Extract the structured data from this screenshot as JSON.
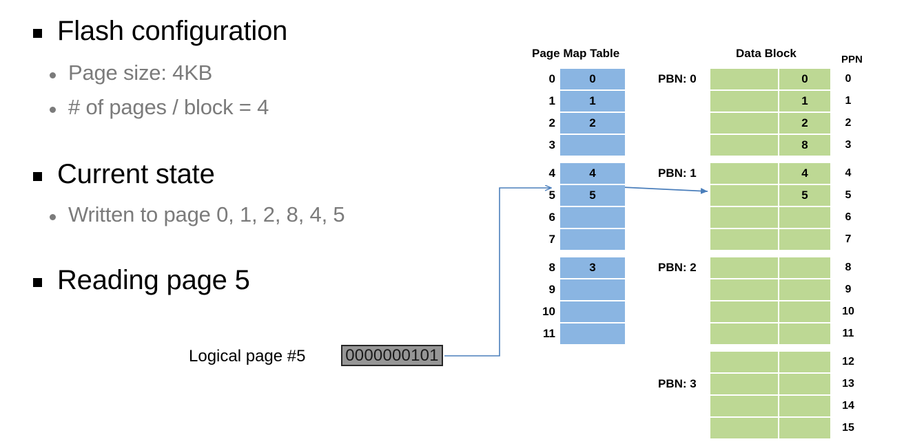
{
  "slide": {
    "bullets": [
      {
        "level": 1,
        "text": "Flash configuration"
      },
      {
        "level": 2,
        "text": "Page size: 4KB"
      },
      {
        "level": 2,
        "text": "# of pages / block = 4"
      },
      {
        "level": 1,
        "text": "Current state"
      },
      {
        "level": 2,
        "text": "Written to page 0, 1, 2, 8, 4, 5"
      },
      {
        "level": 1,
        "text": "Reading page 5"
      }
    ],
    "logical_page_label": "Logical page #5",
    "logical_page_binary": "0000000101"
  },
  "diagram": {
    "page_map_table": {
      "title": "Page Map Table",
      "groups": [
        {
          "rows": [
            {
              "index": "0",
              "value": "0"
            },
            {
              "index": "1",
              "value": "1"
            },
            {
              "index": "2",
              "value": "2"
            },
            {
              "index": "3",
              "value": ""
            }
          ]
        },
        {
          "rows": [
            {
              "index": "4",
              "value": "4"
            },
            {
              "index": "5",
              "value": "5"
            },
            {
              "index": "6",
              "value": ""
            },
            {
              "index": "7",
              "value": ""
            }
          ]
        },
        {
          "rows": [
            {
              "index": "8",
              "value": "3"
            },
            {
              "index": "9",
              "value": ""
            },
            {
              "index": "10",
              "value": ""
            },
            {
              "index": "11",
              "value": ""
            }
          ]
        }
      ]
    },
    "data_block": {
      "title": "Data Block",
      "ppn_title": "PPN",
      "groups": [
        {
          "pbn": "PBN: 0",
          "pbn_row": 0,
          "rows": [
            {
              "value": "0",
              "ppn": "0"
            },
            {
              "value": "1",
              "ppn": "1"
            },
            {
              "value": "2",
              "ppn": "2"
            },
            {
              "value": "8",
              "ppn": "3"
            }
          ]
        },
        {
          "pbn": "PBN: 1",
          "pbn_row": 0,
          "rows": [
            {
              "value": "4",
              "ppn": "4"
            },
            {
              "value": "5",
              "ppn": "5"
            },
            {
              "value": "",
              "ppn": "6"
            },
            {
              "value": "",
              "ppn": "7"
            }
          ]
        },
        {
          "pbn": "PBN: 2",
          "pbn_row": 0,
          "rows": [
            {
              "value": "",
              "ppn": "8"
            },
            {
              "value": "",
              "ppn": "9"
            },
            {
              "value": "",
              "ppn": "10"
            },
            {
              "value": "",
              "ppn": "11"
            }
          ]
        },
        {
          "pbn": "PBN: 3",
          "pbn_row": 1,
          "rows": [
            {
              "value": "",
              "ppn": "12"
            },
            {
              "value": "",
              "ppn": "13"
            },
            {
              "value": "",
              "ppn": "14"
            },
            {
              "value": "",
              "ppn": "15"
            }
          ]
        }
      ]
    }
  },
  "colors": {
    "page_map_cell": "#8ab5e2",
    "data_block_cell": "#bdd894",
    "binary_box_fill": "#969696",
    "binary_box_border": "#262626",
    "connector": "#4a7ebb",
    "sub_bullet_text": "#7b7b7b"
  }
}
